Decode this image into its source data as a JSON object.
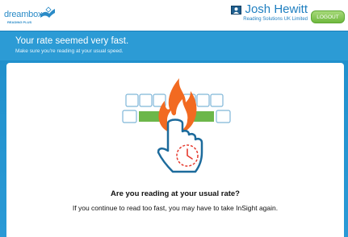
{
  "header": {
    "logo_text": "dreambox",
    "logo_subtext": "READING PLUS",
    "user_name": "Josh Hewitt",
    "org_name": "Reading Solutions UK Limited",
    "logout_label": "LOGOUT"
  },
  "banner": {
    "title": "Your rate seemed very fast.",
    "subtitle": "Make sure you're reading at your usual speed."
  },
  "content": {
    "illustration_icon": "fast-reading-flame-icon",
    "question": "Are you reading at your usual rate?",
    "message": "If you continue to read too fast, you may have to take InSight again."
  },
  "colors": {
    "brand_blue": "#2c9bd5",
    "logout_green": "#7cc24a",
    "flame_orange": "#f26a21",
    "bar_green": "#6cb74a"
  }
}
